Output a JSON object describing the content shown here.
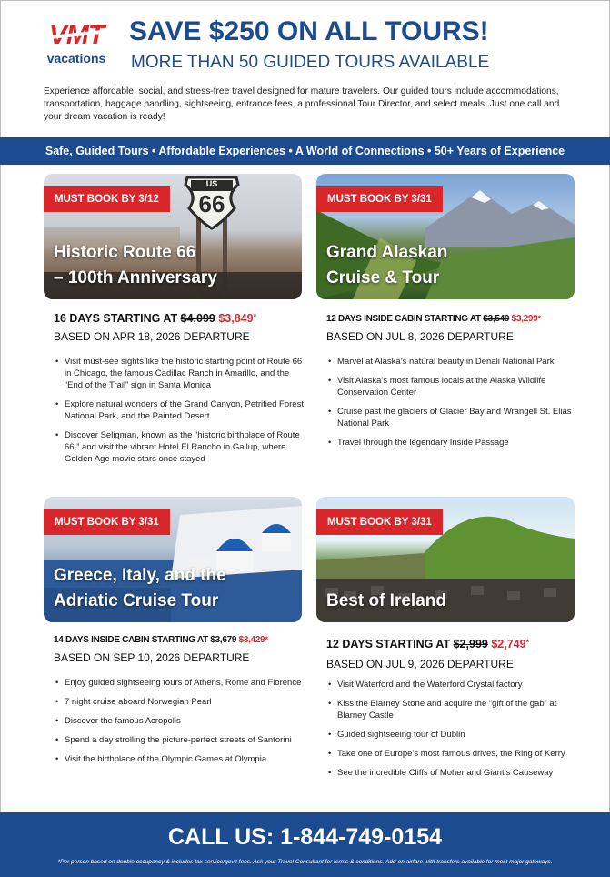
{
  "brand": {
    "logo_mark": "VMT",
    "logo_sub": "vacations",
    "brand_color": "#1d4b8f",
    "accent_color": "#d8262b"
  },
  "header": {
    "headline": "SAVE $250 ON ALL TOURS!",
    "subheadline": "MORE THAN 50 GUIDED TOURS AVAILABLE"
  },
  "intro": "Experience affordable, social, and stress-free travel designed for mature travelers. Our guided tours include accommodations, transportation, baggage handling, sightseeing, entrance fees, a professional Tour Director, and select meals. Just one call and your dream vacation is ready!",
  "banner": "Safe, Guided Tours • Affordable Experiences • A World of Connections • 50+ Years of Experience",
  "tours": [
    {
      "badge": "MUST BOOK BY 3/12",
      "title_line1": "Historic Route 66",
      "title_line2": "– 100th Anniversary",
      "price_prefix": "16 DAYS STARTING AT ",
      "old_price": "$4,099",
      "new_price": "$3,849",
      "asterisk": "*",
      "departure": "BASED ON APR 18, 2026 DEPARTURE",
      "highlights": [
        "Visit must-see sights like the historic starting point of Route 66 in Chicago, the famous Cadillac Ranch in Amarillo, and the “End of the Trail” sign in Santa Monica",
        "Explore natural wonders of the Grand Canyon, Petrified Forest National Park, and the Painted Desert",
        "Discover Seligman, known as the “historic birthplace of Route 66,” and visit the vibrant Hotel El Rancho in Gallup, where Golden Age movie stars once stayed"
      ],
      "sign_top": "US",
      "sign_num": "66"
    },
    {
      "badge": "MUST BOOK BY 3/31",
      "title_line1": "Grand Alaskan",
      "title_line2": "Cruise & Tour",
      "price_prefix": "12 DAYS INSIDE CABIN STARTING AT ",
      "old_price": "$3,549",
      "new_price": "$3,299",
      "asterisk": "*",
      "departure": "BASED ON JUL 8, 2026 DEPARTURE",
      "highlights": [
        "Marvel at Alaska’s natural beauty in Denali National Park",
        "Visit Alaska’s most famous locals at the Alaska Wildlife Conservation Center",
        "Cruise past the glaciers of Glacier Bay and Wrangell St. Elias National Park",
        "Travel through the legendary Inside Passage"
      ]
    },
    {
      "badge": "MUST BOOK BY 3/31",
      "title_line1": "Greece, Italy, and the",
      "title_line2": "Adriatic Cruise Tour",
      "price_prefix": "14 DAYS INSIDE CABIN STARTING AT ",
      "old_price": "$3,679",
      "new_price": "$3,429",
      "asterisk": "*",
      "departure": "BASED ON SEP 10, 2026 DEPARTURE",
      "highlights": [
        "Enjoy guided sightseeing tours of Athens, Rome and Florence",
        "7 night cruise aboard Norwegian Pearl",
        "Discover the famous Acropolis",
        "Spend a day strolling the picture-perfect streets of Santorini",
        "Visit the birthplace of the Olympic Games at Olympia"
      ]
    },
    {
      "badge": "MUST BOOK BY 3/31",
      "title_line1": "Best of Ireland",
      "title_line2": "",
      "price_prefix": "12 DAYS STARTING AT ",
      "old_price": "$2,999",
      "new_price": "$2,749",
      "asterisk": "*",
      "departure": "BASED ON JUL 9, 2026 DEPARTURE",
      "highlights": [
        "Visit Waterford and the Waterford Crystal factory",
        "Kiss the Blarney Stone and acquire the “gift of the gab” at Blarney Castle",
        "Guided sightseeing tour of Dublin",
        "Take one of Europe’s most famous drives, the Ring of Kerry",
        "See the incredible Cliffs of Moher and Giant’s Causeway"
      ]
    }
  ],
  "footer": {
    "call": "CALL US: 1-844-749-0154",
    "disclaimer": "*Per person based on double occupancy & includes tax service/gov’t fees. Ask your Travel Consultant for terms & conditions. Add-on airfare with transfers available for most major gateways."
  }
}
